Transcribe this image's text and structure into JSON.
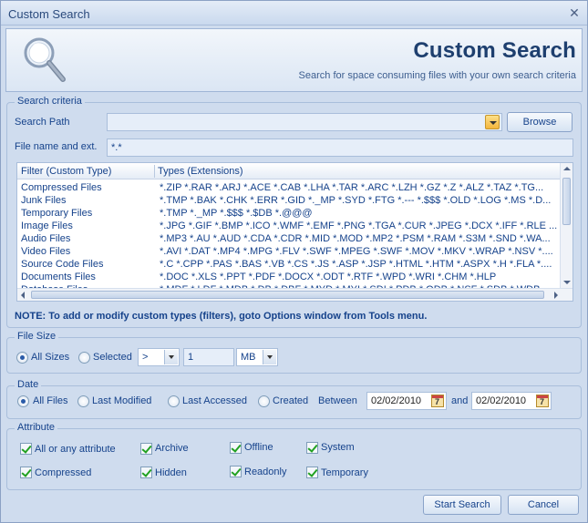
{
  "window": {
    "title": "Custom Search"
  },
  "banner": {
    "heading": "Custom Search",
    "subtitle": "Search for space consuming files with your own search criteria"
  },
  "criteria": {
    "group_label": "Search criteria",
    "path_label": "Search Path",
    "path_value": "",
    "browse_label": "Browse",
    "name_label": "File name and ext.",
    "name_value": "*.*",
    "col_filter": "Filter (Custom Type)",
    "col_types": "Types (Extensions)",
    "rows": [
      {
        "filter": "Compressed Files",
        "types": "*.ZIP *.RAR *.ARJ *.ACE *.CAB *.LHA *.TAR *.ARC *.LZH *.GZ *.Z *.ALZ *.TAZ *.TG..."
      },
      {
        "filter": "Junk Files",
        "types": "*.TMP *.BAK *.CHK *.ERR *.GID *._MP *.SYD *.FTG *.--- *.$$$ *.OLD *.LOG *.MS *.D..."
      },
      {
        "filter": "Temporary Files",
        "types": "*.TMP *._MP *.$$$ *.$DB *.@@@"
      },
      {
        "filter": "Image Files",
        "types": "*.JPG *.GIF *.BMP *.ICO *.WMF *.EMF *.PNG *.TGA *.CUR *.JPEG *.DCX *.IFF *.RLE ..."
      },
      {
        "filter": "Audio Files",
        "types": "*.MP3 *.AU *.AUD *.CDA *.CDR *.MID *.MOD *.MP2 *.PSM *.RAM *.S3M *.SND *.WA..."
      },
      {
        "filter": "Video Files",
        "types": "*.AVI *.DAT *.MP4 *.MPG *.FLV *.SWF *.MPEG *.SWF *.MOV *.MKV *.WRAP *.NSV *...."
      },
      {
        "filter": "Source Code Files",
        "types": "*.C *.CPP *.PAS *.BAS *.VB *.CS *.JS *.ASP *.JSP *.HTML *.HTM *.ASPX *.H *.FLA *...."
      },
      {
        "filter": "Documents Files",
        "types": "*.DOC *.XLS *.PPT *.PDF *.DOCX *.ODT *.RTF *.WPD *.WRI *.CHM *.HLP"
      },
      {
        "filter": "Database Files",
        "types": "*.MDF *.LDF *.MDB *.DB *.DBF *.MYD *.MYI *.SDI *.PDB *.ODB *.NSF *.SDB *.WDB"
      }
    ],
    "note": "NOTE: To add or modify custom types (filters), goto Options window from Tools menu."
  },
  "filesize": {
    "group_label": "File Size",
    "all_sizes": "All Sizes",
    "selected": "Selected",
    "operator": ">",
    "amount": "1",
    "unit": "MB"
  },
  "date": {
    "group_label": "Date",
    "all_files": "All Files",
    "last_modified": "Last Modified",
    "last_accessed": "Last Accessed",
    "created": "Created",
    "between": "Between",
    "from": "02/02/2010",
    "and": "and",
    "to": "02/02/2010"
  },
  "attribute": {
    "group_label": "Attribute",
    "items": [
      "All or any attribute",
      "Archive",
      "Offline",
      "System",
      "Compressed",
      "Hidden",
      "Readonly",
      "Temporary"
    ]
  },
  "footer": {
    "start": "Start Search",
    "cancel": "Cancel"
  }
}
